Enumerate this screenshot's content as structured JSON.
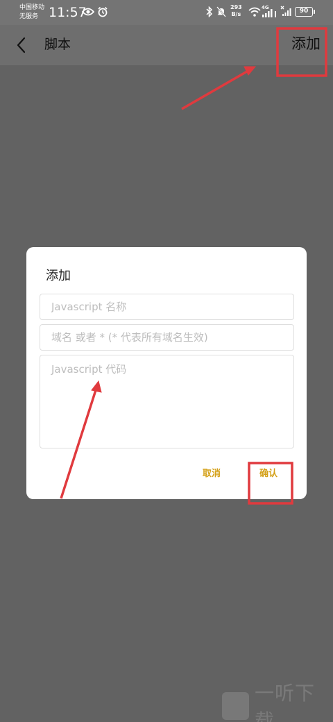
{
  "status_bar": {
    "carrier_line1": "中国移动",
    "carrier_line2": "无服务",
    "time": "11:57",
    "speed_value": "293",
    "speed_unit": "B/s",
    "network": "4G",
    "battery": "90"
  },
  "app_bar": {
    "title": "脚本",
    "add_label": "添加"
  },
  "dialog": {
    "title": "添加",
    "name_placeholder": "Javascript 名称",
    "domain_placeholder": "域名 或者 * (* 代表所有域名生效)",
    "code_placeholder": "Javascript 代码",
    "cancel_label": "取消",
    "confirm_label": "确认"
  },
  "colors": {
    "accent": "#d4a017",
    "annotation": "#e03a3e",
    "overlay": "#626262"
  },
  "watermark": {
    "text": "一听下载"
  }
}
